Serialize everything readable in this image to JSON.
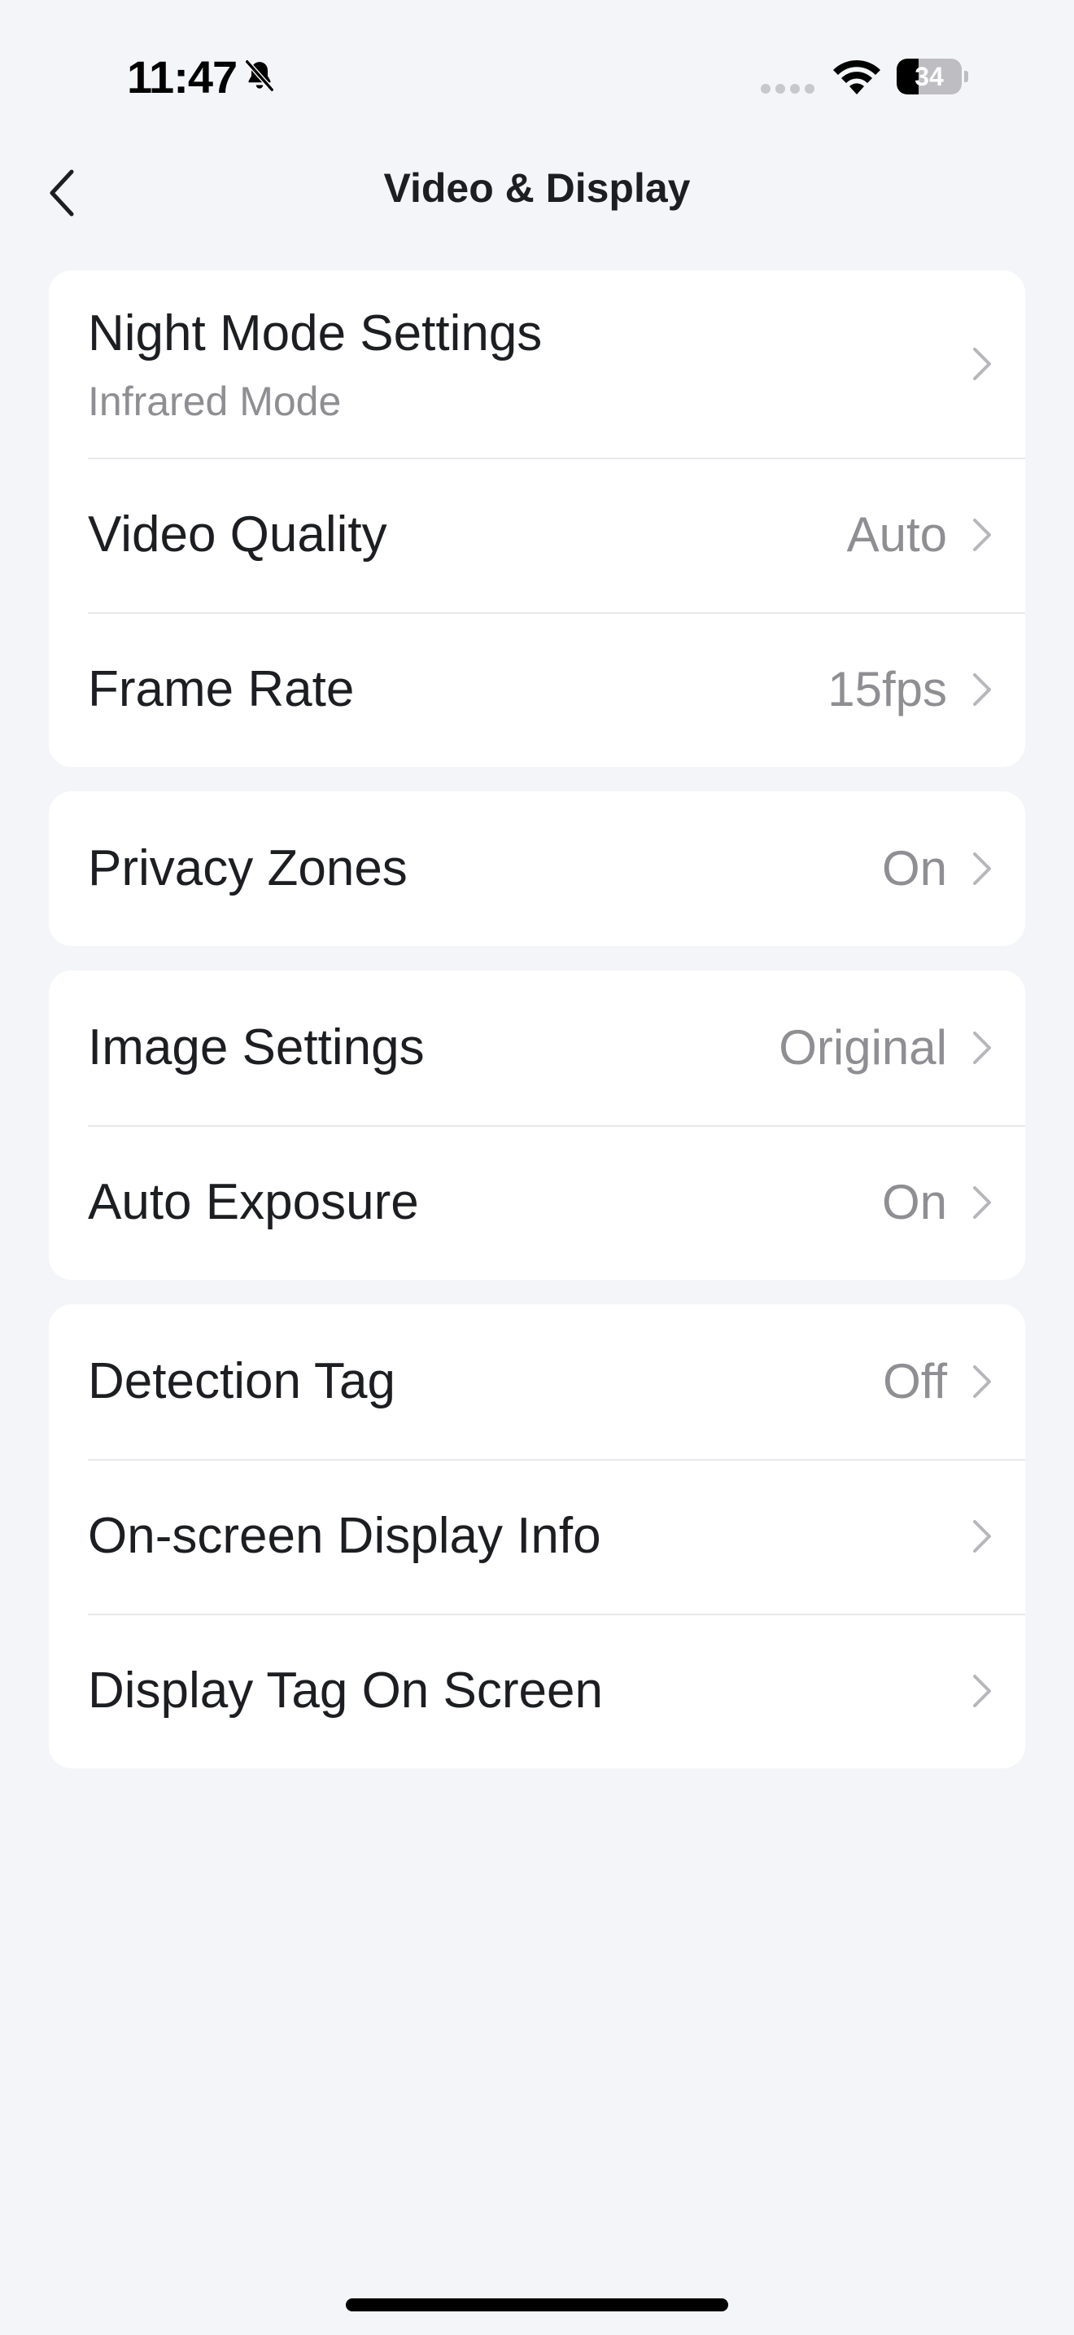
{
  "status_bar": {
    "time": "11:47",
    "battery_level": "34",
    "battery_fraction": 0.34,
    "icons": [
      "bell-slash-icon",
      "cellular-signal-icon",
      "wifi-icon",
      "battery-icon"
    ]
  },
  "nav": {
    "back_icon": "chevron-left-icon",
    "title": "Video & Display"
  },
  "groups": [
    {
      "rows": [
        {
          "label": "Night Mode Settings",
          "subtitle": "Infrared Mode",
          "value": ""
        },
        {
          "label": "Video Quality",
          "value": "Auto"
        },
        {
          "label": "Frame Rate",
          "value": "15fps"
        }
      ]
    },
    {
      "rows": [
        {
          "label": "Privacy Zones",
          "value": "On"
        }
      ]
    },
    {
      "rows": [
        {
          "label": "Image Settings",
          "value": "Original"
        },
        {
          "label": "Auto Exposure",
          "value": "On"
        }
      ]
    },
    {
      "rows": [
        {
          "label": "Detection Tag",
          "value": "Off"
        },
        {
          "label": "On-screen Display Info",
          "value": ""
        },
        {
          "label": "Display Tag On Screen",
          "value": ""
        }
      ]
    }
  ],
  "colors": {
    "background": "#f4f5f9",
    "card": "#ffffff",
    "text_primary": "#1c1e21",
    "text_secondary": "#8e8e93",
    "chevron": "#b6b6bb",
    "divider": "#e8e8ec"
  }
}
